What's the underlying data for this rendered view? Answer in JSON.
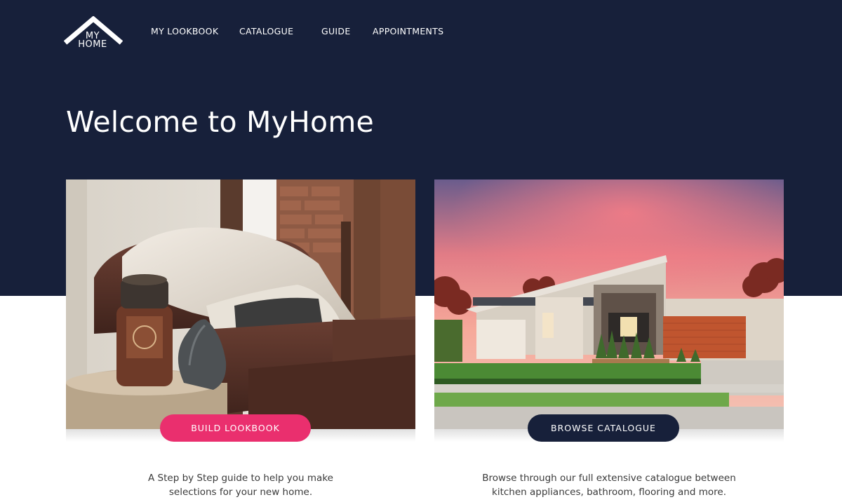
{
  "brand": {
    "logo_line1": "MY",
    "logo_line2": "HOME"
  },
  "nav": [
    {
      "label": "MY LOOKBOOK"
    },
    {
      "label": "CATALOGUE"
    },
    {
      "label": "GUIDE"
    },
    {
      "label": "APPOINTMENTS"
    }
  ],
  "hero": {
    "title": "Welcome to MyHome"
  },
  "cards": [
    {
      "button_label": "BUILD LOOKBOOK",
      "description_line1": "A Step by Step guide to help you make",
      "description_line2": "selections for your new home."
    },
    {
      "button_label": "BROWSE CATALOGUE",
      "description_line1": "Browse through our full extensive catalogue between",
      "description_line2": "kitchen appliances, bathroom, flooring and more."
    }
  ],
  "colors": {
    "navy": "#17203a",
    "accent_pink": "#ea2f6e",
    "white": "#ffffff"
  }
}
